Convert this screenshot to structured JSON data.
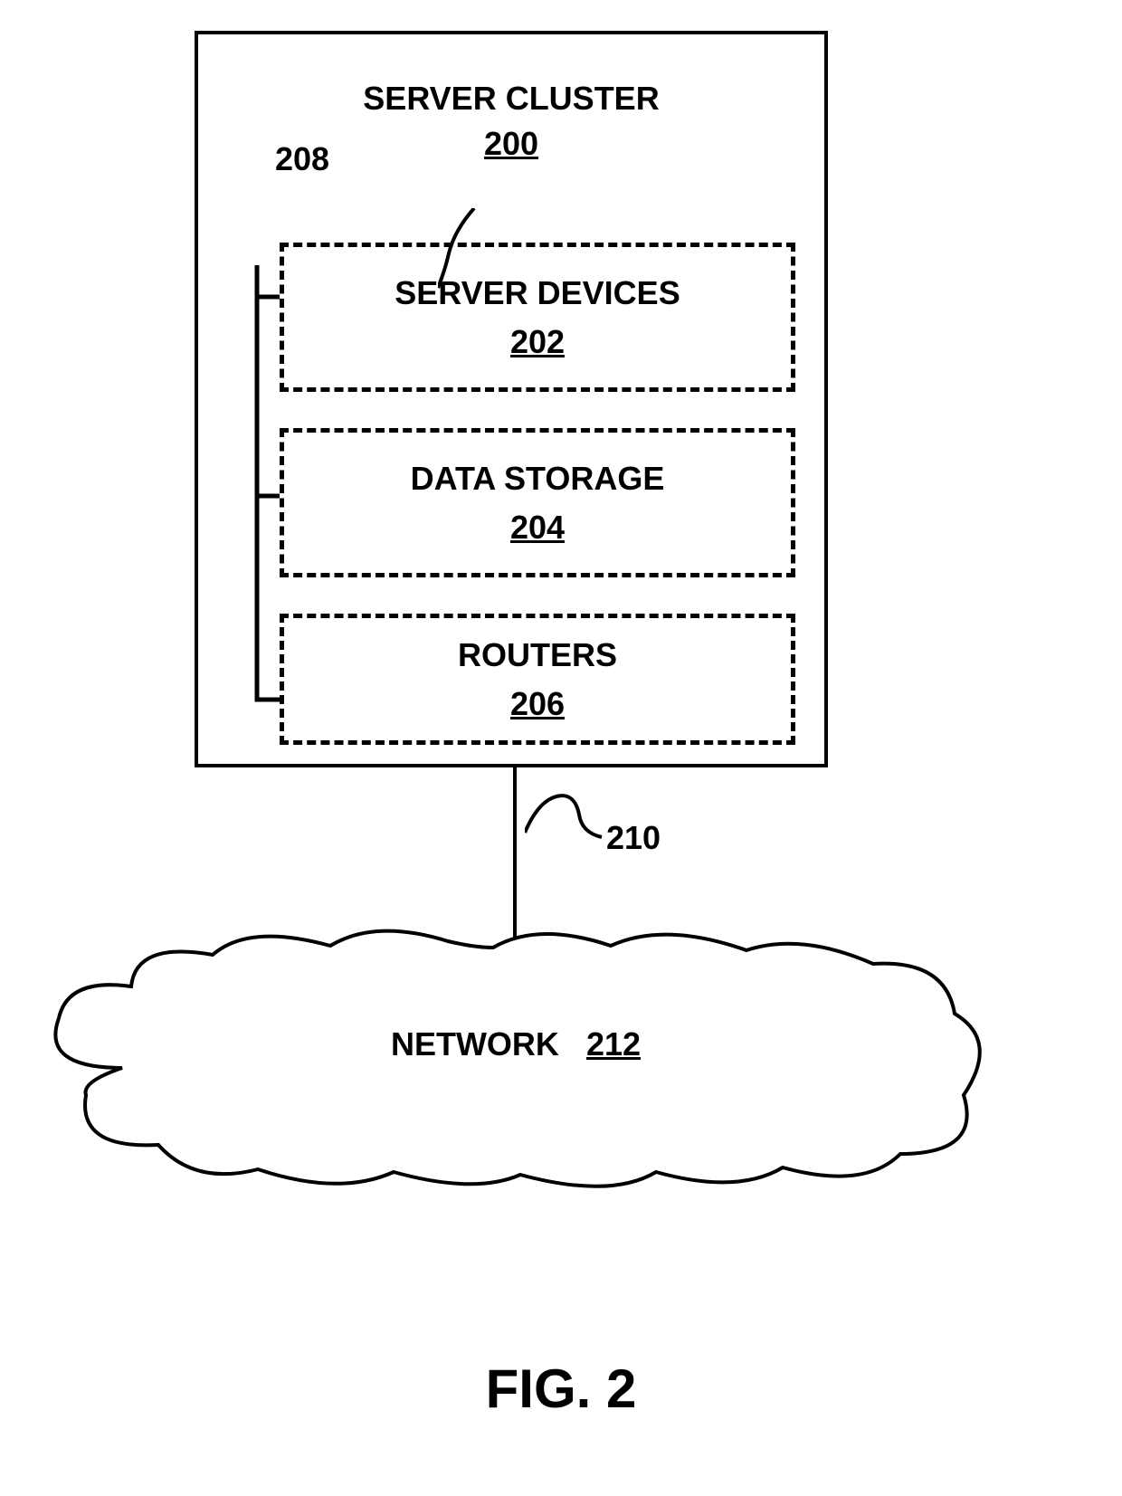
{
  "cluster": {
    "title": "SERVER CLUSTER",
    "ref": "200",
    "busRef": "208",
    "boxes": {
      "serverDevices": {
        "label": "SERVER DEVICES",
        "ref": "202"
      },
      "dataStorage": {
        "label": "DATA STORAGE",
        "ref": "204"
      },
      "routers": {
        "label": "ROUTERS",
        "ref": "206"
      }
    }
  },
  "connectionRef": "210",
  "network": {
    "label": "NETWORK",
    "ref": "212"
  },
  "figureLabel": "FIG. 2"
}
